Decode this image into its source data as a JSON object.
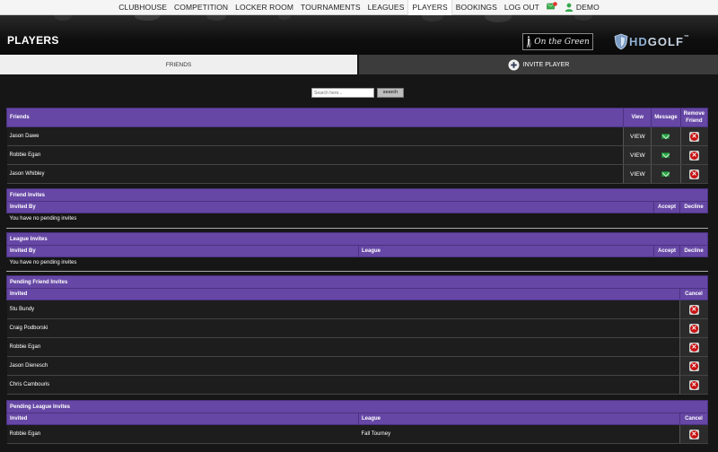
{
  "nav": {
    "items": [
      {
        "label": "CLUBHOUSE"
      },
      {
        "label": "COMPETITION"
      },
      {
        "label": "LOCKER ROOM"
      },
      {
        "label": "TOURNAMENTS"
      },
      {
        "label": "LEAGUES"
      },
      {
        "label": "PLAYERS",
        "active": true
      },
      {
        "label": "BOOKINGS"
      },
      {
        "label": "LOG OUT"
      }
    ],
    "user_label": "DEMO",
    "mail_icon": "mail-notification-icon",
    "user_icon": "user-icon"
  },
  "header": {
    "title": "PLAYERS",
    "logo_on_the_green": "On the Green",
    "logo_hd": "HD",
    "logo_golf": "GOLF",
    "logo_tm": "™"
  },
  "tabs": {
    "friends": "FRIENDS",
    "invite_player": "INVITE PLAYER"
  },
  "search": {
    "placeholder": "Search here...",
    "button": "search"
  },
  "friends": {
    "headers": {
      "name": "Friends",
      "view": "View",
      "message": "Message",
      "remove": "Remove Friend"
    },
    "rows": [
      {
        "name": "Jason Dawe",
        "view": "VIEW"
      },
      {
        "name": "Robbie Egan",
        "view": "VIEW"
      },
      {
        "name": "Jason Whibley",
        "view": "VIEW"
      }
    ]
  },
  "friend_invites": {
    "title": "Friend Invites",
    "headers": {
      "invited_by": "Invited By",
      "accept": "Accept",
      "decline": "Decline"
    },
    "empty": "You have no pending invites"
  },
  "league_invites": {
    "title": "League Invites",
    "headers": {
      "invited_by": "Invited By",
      "league": "League",
      "accept": "Accept",
      "decline": "Decline"
    },
    "empty": "You have no pending invites"
  },
  "pending_friend_invites": {
    "title": "Pending Friend Invites",
    "headers": {
      "invited": "Invited",
      "cancel": "Cancel"
    },
    "rows": [
      {
        "name": "Stu Bundy"
      },
      {
        "name": "Craig Podborski"
      },
      {
        "name": "Robbie Egan"
      },
      {
        "name": "Jason Dienesch"
      },
      {
        "name": "Chris Cambouris"
      }
    ]
  },
  "pending_league_invites": {
    "title": "Pending League Invites",
    "headers": {
      "invited": "Invited",
      "league": "League",
      "cancel": "Cancel"
    },
    "rows": [
      {
        "name": "Robbie Egan",
        "league": "Fall Tourney"
      }
    ]
  },
  "colors": {
    "accent_purple": "#6647a5",
    "delete_red": "#c81010",
    "message_green": "#2ea84a"
  }
}
